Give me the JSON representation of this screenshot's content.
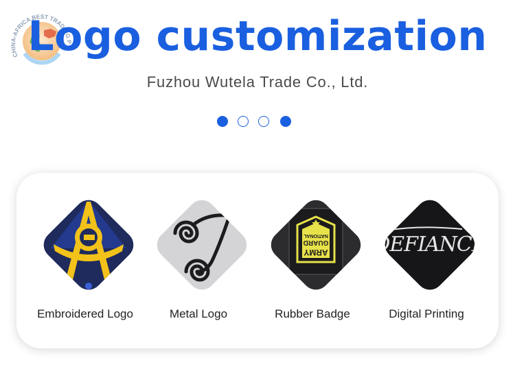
{
  "watermark": {
    "ring_text": "CHINA-AFRICA BEST TRADING PLATFORM",
    "icon": "globe-map-icon"
  },
  "header": {
    "title": "Logo customization",
    "subtitle": "Fuzhou Wutela Trade Co., Ltd."
  },
  "carousel": {
    "dots": [
      "filled",
      "hollow",
      "hollow",
      "filled"
    ],
    "color": "#1a5fe0"
  },
  "products": [
    {
      "label": "Embroidered Logo",
      "icon": "embroidered-patch-image"
    },
    {
      "label": "Metal Logo",
      "icon": "metal-spiral-image"
    },
    {
      "label": "Rubber Badge",
      "icon": "rubber-badge-image",
      "badge_text": [
        "ARMY",
        "NATIONAL",
        "GUARD"
      ]
    },
    {
      "label": "Digital Printing",
      "icon": "digital-print-image",
      "print_text": "DEFIANCE"
    }
  ],
  "colors": {
    "accent": "#1a5fe0",
    "text": "#222222",
    "subtitle": "#4a4a4a"
  }
}
